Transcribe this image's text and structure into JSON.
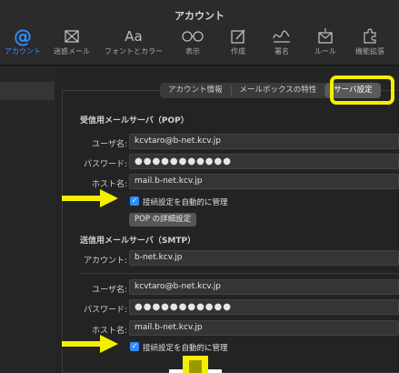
{
  "window": {
    "title": "アカウント"
  },
  "toolbar": {
    "items": [
      {
        "label": "アカウント",
        "icon": "at-icon"
      },
      {
        "label": "迷惑メール",
        "icon": "junk-mail-icon"
      },
      {
        "label": "フォントとカラー",
        "icon": "font-icon"
      },
      {
        "label": "表示",
        "icon": "glasses-icon"
      },
      {
        "label": "作成",
        "icon": "compose-icon"
      },
      {
        "label": "署名",
        "icon": "signature-icon"
      },
      {
        "label": "ルール",
        "icon": "rules-icon"
      },
      {
        "label": "機能拡張",
        "icon": "extensions-icon"
      }
    ],
    "at_glyph": "@",
    "aa_glyph": "Aa"
  },
  "tabs": [
    {
      "label": "アカウント情報",
      "selected": false
    },
    {
      "label": "メールボックスの特性",
      "selected": false
    },
    {
      "label": "サーバ設定",
      "selected": true
    }
  ],
  "incoming": {
    "title": "受信用メールサーバ（POP）",
    "username_label": "ユーザ名:",
    "username": "kcvtaro@b-net.kcv.jp",
    "password_label": "パスワード:",
    "password": "●●●●●●●●●●●",
    "host_label": "ホスト名:",
    "host": "mail.b-net.kcv.jp",
    "auto_manage": "接続設定を自動的に管理",
    "auto_manage_checked": true,
    "pop_details_button": "POP の詳細設定"
  },
  "outgoing": {
    "title": "送信用メールサーバ（SMTP）",
    "account_label": "アカウント:",
    "account": "b-net.kcv.jp",
    "username_label": "ユーザ名:",
    "username": "kcvtaro@b-net.kcv.jp",
    "password_label": "パスワード:",
    "password": "●●●●●●●●●●●",
    "host_label": "ホスト名:",
    "host": "mail.b-net.kcv.jp",
    "auto_manage": "接続設定を自動的に管理",
    "auto_manage_checked": true
  },
  "colors": {
    "accent": "#2f8cff",
    "highlight": "#f2ef00",
    "background": "#1e1e1e"
  }
}
